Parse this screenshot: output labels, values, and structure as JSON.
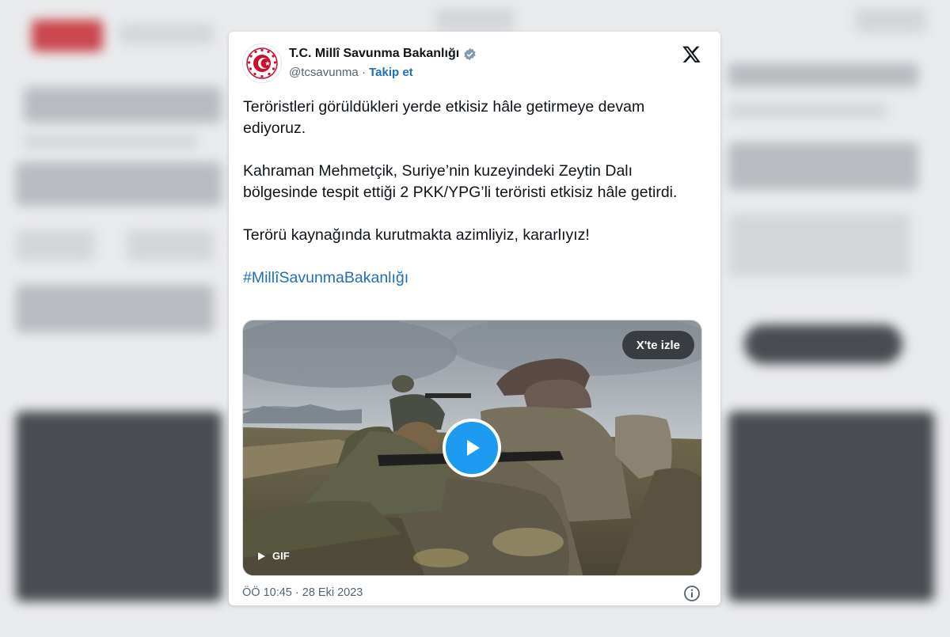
{
  "tweet": {
    "author_name": "T.C. Millî Savunma Bakanlığı",
    "handle": "@tcsavunma",
    "separator": "·",
    "follow_label": "Takip et",
    "paragraphs": [
      "Teröristleri görüldükleri yerde etkisiz hâle getirmeye devam ediyoruz.",
      "Kahraman Mehmetçik, Suriye’nin kuzeyindeki Zeytin Dalı bölgesinde tespit ettiği 2 PKK/YPG’li teröristi etkisiz hâle getirdi.",
      "Terörü kaynağında kurutmakta azimliyiz, kararlıyız!"
    ],
    "hashtag": "#MillîSavunmaBakanlığı",
    "timestamp": "ÖÖ 10:45 · 28 Eki 2023"
  },
  "media": {
    "watch_label": "X'te izle",
    "gif_label": "GIF"
  },
  "icons": {
    "verified": "verified-badge-icon",
    "platform": "x-logo-icon",
    "play": "play-icon",
    "info": "info-icon"
  },
  "colors": {
    "link_blue": "#1d6fb8",
    "play_blue": "#1d9bf0",
    "brand_red": "#c8102e"
  }
}
